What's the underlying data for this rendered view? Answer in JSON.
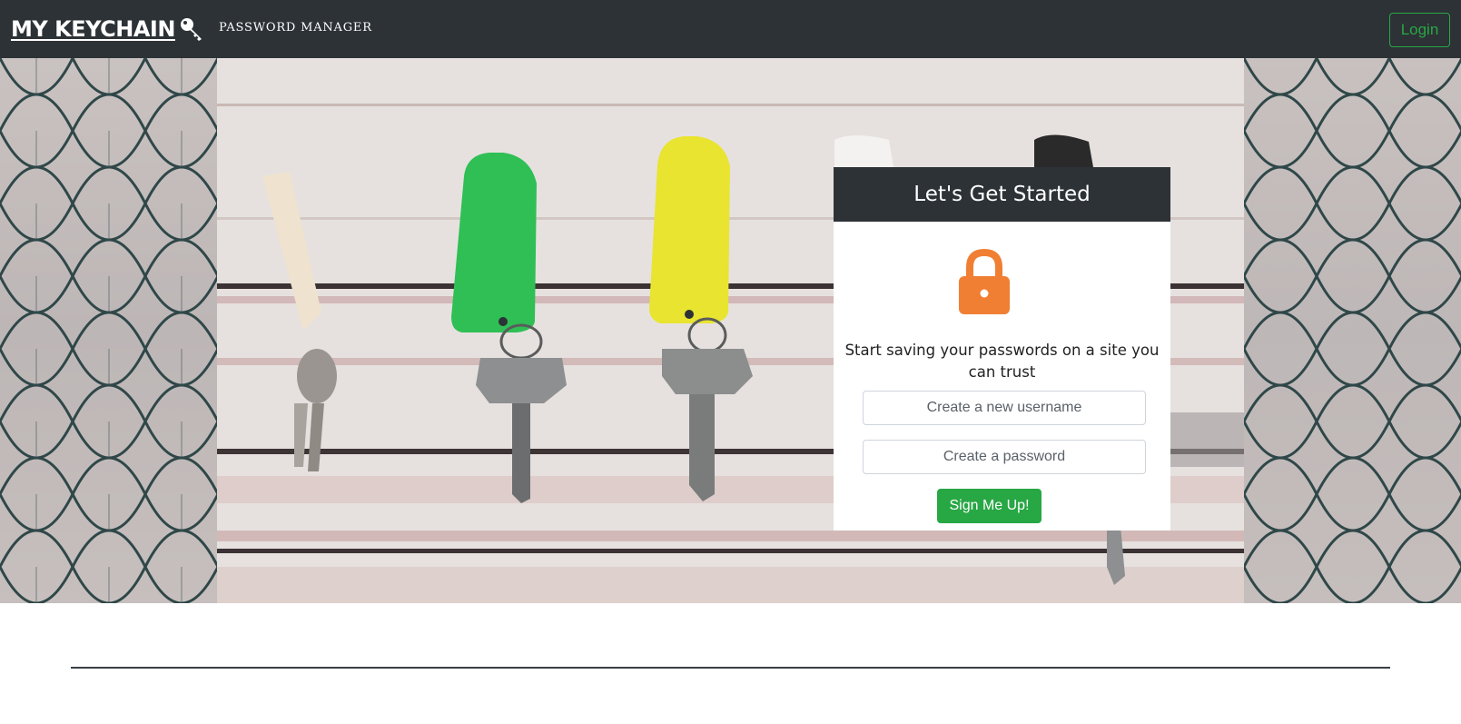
{
  "navbar": {
    "brand": "MY KEYCHAIN",
    "brand_icon": "key-icon",
    "tagline": "PASSWORD MANAGER",
    "login_label": "Login"
  },
  "signup_card": {
    "title": "Let's Get Started",
    "icon": "lock-icon",
    "description": "Start saving your passwords on a site you can trust",
    "username_placeholder": "Create a new username",
    "password_placeholder": "Create a password",
    "submit_label": "Sign Me Up!"
  },
  "colors": {
    "navbar_bg": "#2d3236",
    "accent_green": "#28a745",
    "lock_orange": "#f07f33"
  }
}
